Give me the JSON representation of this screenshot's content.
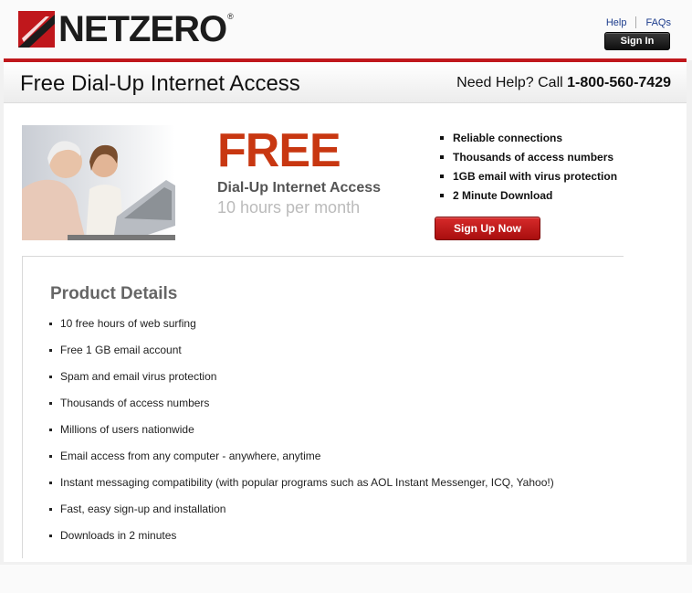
{
  "header": {
    "logo_text": "NETZERO",
    "logo_reg": "®",
    "help_link": "Help",
    "faqs_link": "FAQs",
    "signin_button": "Sign In"
  },
  "titlebar": {
    "title": "Free Dial-Up Internet Access",
    "help_prefix": "Need Help? Call ",
    "phone": "1-800-560-7429"
  },
  "hero": {
    "image_alt": "grandmother and granddaughter at laptop",
    "free_heading": "FREE",
    "subheading": "Dial-Up Internet Access",
    "hours": "10 hours per month",
    "features": [
      "Reliable connections",
      "Thousands of access numbers",
      "1GB email with virus protection",
      "2 Minute Download"
    ],
    "signup_button": "Sign Up Now"
  },
  "product_details": {
    "title": "Product Details",
    "items": [
      "10 free hours of web surfing",
      "Free 1 GB email account",
      "Spam and email virus protection",
      "Thousands of access numbers",
      "Millions of users nationwide",
      "Email access from any computer - anywhere, anytime",
      "Instant messaging compatibility (with popular programs such as AOL Instant Messenger, ICQ, Yahoo!)",
      "Fast, easy sign-up and installation",
      "Downloads in 2 minutes"
    ]
  },
  "colors": {
    "brand_red": "#c0171c",
    "free_orange": "#c83711",
    "link_blue": "#1b3b8c"
  }
}
